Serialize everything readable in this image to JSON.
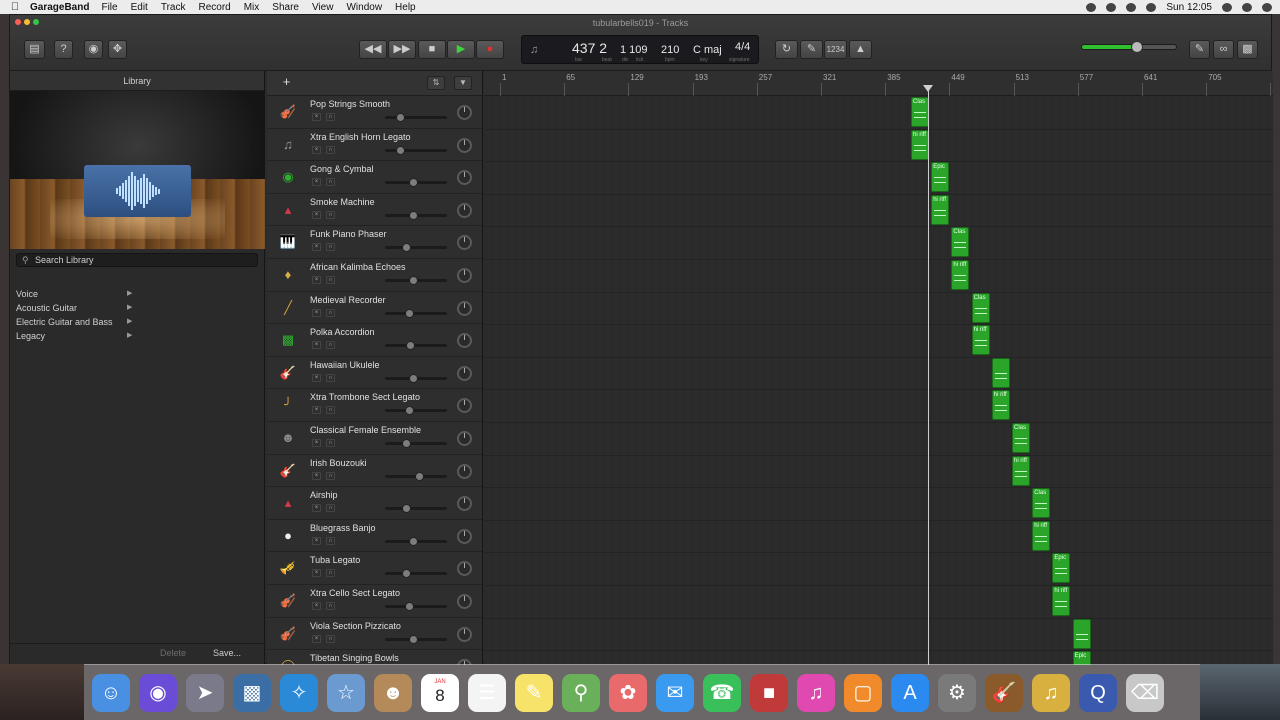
{
  "menubar": {
    "app_name": "GarageBand",
    "menus": [
      "File",
      "Edit",
      "Track",
      "Record",
      "Mix",
      "Share",
      "View",
      "Window",
      "Help"
    ],
    "clock": "Sun 12:05"
  },
  "window": {
    "title": "tubularbells019 - Tracks"
  },
  "transport": {
    "bar_beat": "437 2",
    "beat_div_tick": "1 109",
    "tempo": "210",
    "key": "C maj",
    "signature": "4/4",
    "labels": {
      "bar": "bar",
      "beat": "beat",
      "div": "div",
      "tick": "tick",
      "bpm": "bpm",
      "key": "key",
      "signature": "signature"
    },
    "count_in": "1234",
    "master_volume_fraction": 0.58
  },
  "library": {
    "title": "Library",
    "search_placeholder": "Search Library",
    "categories": [
      "Voice",
      "Acoustic Guitar",
      "Electric Guitar and Bass",
      "Legacy"
    ],
    "delete_label": "Delete",
    "save_label": "Save..."
  },
  "tracks": [
    {
      "name": "Pop Strings Smooth",
      "icon": "violin-icon",
      "volume": 0.2
    },
    {
      "name": "Xtra English Horn Legato",
      "icon": "horn-icon",
      "volume": 0.2
    },
    {
      "name": "Gong & Cymbal",
      "icon": "percussion-icon",
      "volume": 0.45
    },
    {
      "name": "Smoke Machine",
      "icon": "synth-icon",
      "volume": 0.45
    },
    {
      "name": "Funk Piano Phaser",
      "icon": "piano-icon",
      "volume": 0.32
    },
    {
      "name": "African Kalimba Echoes",
      "icon": "kalimba-icon",
      "volume": 0.45
    },
    {
      "name": "Medieval Recorder",
      "icon": "recorder-icon",
      "volume": 0.38
    },
    {
      "name": "Polka Accordion",
      "icon": "accordion-icon",
      "volume": 0.4
    },
    {
      "name": "Hawaiian Ukulele",
      "icon": "ukulele-icon",
      "volume": 0.45
    },
    {
      "name": "Xtra Trombone Sect Legato",
      "icon": "trombone-icon",
      "volume": 0.38
    },
    {
      "name": "Classical Female Ensemble",
      "icon": "choir-icon",
      "volume": 0.32
    },
    {
      "name": "Irish Bouzouki",
      "icon": "bouzouki-icon",
      "volume": 0.57
    },
    {
      "name": "Airship",
      "icon": "synth-icon",
      "volume": 0.32
    },
    {
      "name": "Bluegrass Banjo",
      "icon": "banjo-icon",
      "volume": 0.45
    },
    {
      "name": "Tuba Legato",
      "icon": "tuba-icon",
      "volume": 0.32
    },
    {
      "name": "Xtra Cello Sect Legato",
      "icon": "cello-icon",
      "volume": 0.38
    },
    {
      "name": "Viola Section Pizzicato",
      "icon": "viola-icon",
      "volume": 0.45
    },
    {
      "name": "Tibetan Singing Bowls",
      "icon": "bowl-icon",
      "volume": 0.4
    }
  ],
  "ruler": {
    "bars": [
      "1",
      "65",
      "129",
      "193",
      "257",
      "321",
      "385",
      "449",
      "513",
      "577",
      "641",
      "705",
      "7"
    ]
  },
  "regions": [
    {
      "label": "Clas",
      "track": 0
    },
    {
      "label": "hi riff",
      "track": 1
    },
    {
      "label": "Epic",
      "track": 2
    },
    {
      "label": "hi riff",
      "track": 3
    },
    {
      "label": "Clas",
      "track": 4
    },
    {
      "label": "hi riff",
      "track": 5
    },
    {
      "label": "Clas",
      "track": 6
    },
    {
      "label": "hi riff",
      "track": 7
    },
    {
      "label": "",
      "track": 8
    },
    {
      "label": "hi riff",
      "track": 9
    },
    {
      "label": "Clas",
      "track": 10
    },
    {
      "label": "hi riff",
      "track": 11
    },
    {
      "label": "Clas",
      "track": 12
    },
    {
      "label": "hi riff",
      "track": 13
    },
    {
      "label": "Epic",
      "track": 14
    },
    {
      "label": "hi riff",
      "track": 15
    },
    {
      "label": "",
      "track": 16
    },
    {
      "label": "Epic",
      "track": 17
    }
  ],
  "dock": [
    "finder-icon",
    "siri-icon",
    "launchpad-icon",
    "mission-control-icon",
    "safari-icon",
    "preview-icon",
    "contacts-icon",
    "calendar-icon",
    "reminders-icon",
    "notes-icon",
    "maps-icon",
    "photos-icon",
    "messages-icon",
    "facetime-icon",
    "photo-booth-icon",
    "itunes-icon",
    "ibooks-icon",
    "app-store-icon",
    "system-preferences-icon",
    "garageband-icon",
    "guitar-app-icon",
    "quicktime-icon",
    "trash-icon"
  ],
  "calendar_day": "8",
  "calendar_month": "JAN"
}
